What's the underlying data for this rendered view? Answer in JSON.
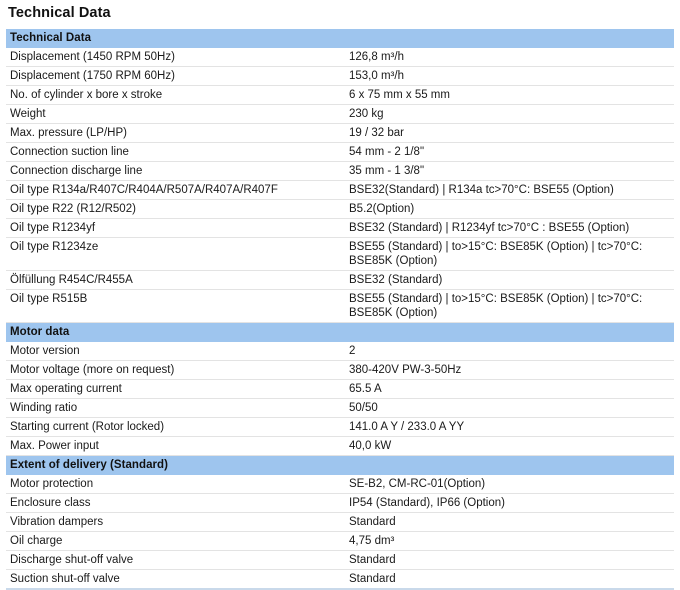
{
  "page": {
    "title": "Technical Data",
    "accent_color": "#9EC5EE",
    "rule_color": "#e3e3e3",
    "text_color": "#1a1a1a"
  },
  "sections": [
    {
      "header": "Technical Data",
      "rows": [
        {
          "label": "Displacement (1450 RPM 50Hz)",
          "value": [
            "126,8 m³/h"
          ]
        },
        {
          "label": "Displacement (1750 RPM 60Hz)",
          "value": [
            "153,0 m³/h"
          ]
        },
        {
          "label": "No. of cylinder x bore x stroke",
          "value": [
            "6 x 75 mm x 55 mm"
          ]
        },
        {
          "label": "Weight",
          "value": [
            "230 kg"
          ]
        },
        {
          "label": "Max. pressure (LP/HP)",
          "value": [
            "19 / 32 bar"
          ]
        },
        {
          "label": "Connection suction line",
          "value": [
            "54 mm - 2 1/8\""
          ]
        },
        {
          "label": "Connection discharge line",
          "value": [
            "35 mm - 1 3/8\""
          ]
        },
        {
          "label": "Oil type R134a/R407C/R404A/R507A/R407A/R407F",
          "value": [
            "BSE32(Standard) | R134a tc>70°C: BSE55 (Option)"
          ]
        },
        {
          "label": "Oil type R22 (R12/R502)",
          "value": [
            "B5.2(Option)"
          ]
        },
        {
          "label": "Oil type R1234yf",
          "value": [
            "BSE32 (Standard) | R1234yf tc>70°C : BSE55 (Option)"
          ]
        },
        {
          "label": "Oil type R1234ze",
          "value": [
            "BSE55 (Standard) | to>15°C: BSE85K (Option) | tc>70°C:",
            "BSE85K (Option)"
          ]
        },
        {
          "label": "Ölfüllung R454C/R455A",
          "value": [
            "BSE32 (Standard)"
          ]
        },
        {
          "label": "Oil type R515B",
          "value": [
            "BSE55 (Standard) | to>15°C: BSE85K (Option) | tc>70°C:",
            "BSE85K (Option)"
          ]
        }
      ]
    },
    {
      "header": "Motor data",
      "rows": [
        {
          "label": "Motor version",
          "value": [
            "2"
          ]
        },
        {
          "label": "Motor voltage (more on request)",
          "value": [
            "380-420V PW-3-50Hz"
          ]
        },
        {
          "label": "Max operating current",
          "value": [
            "65.5 A"
          ]
        },
        {
          "label": "Winding ratio",
          "value": [
            "50/50"
          ]
        },
        {
          "label": "Starting current (Rotor locked)",
          "value": [
            "141.0 A Y / 233.0 A YY"
          ]
        },
        {
          "label": "Max. Power input",
          "value": [
            "40,0 kW"
          ]
        }
      ]
    },
    {
      "header": "Extent of delivery (Standard)",
      "rows": [
        {
          "label": "Motor protection",
          "value": [
            "SE-B2, CM-RC-01(Option)"
          ]
        },
        {
          "label": "Enclosure class",
          "value": [
            "IP54 (Standard), IP66 (Option)"
          ]
        },
        {
          "label": "Vibration dampers",
          "value": [
            "Standard"
          ]
        },
        {
          "label": "Oil charge",
          "value": [
            "4,75 dm³"
          ]
        },
        {
          "label": "Discharge shut-off valve",
          "value": [
            "Standard"
          ]
        },
        {
          "label": "Suction shut-off valve",
          "value": [
            "Standard"
          ]
        }
      ]
    }
  ]
}
